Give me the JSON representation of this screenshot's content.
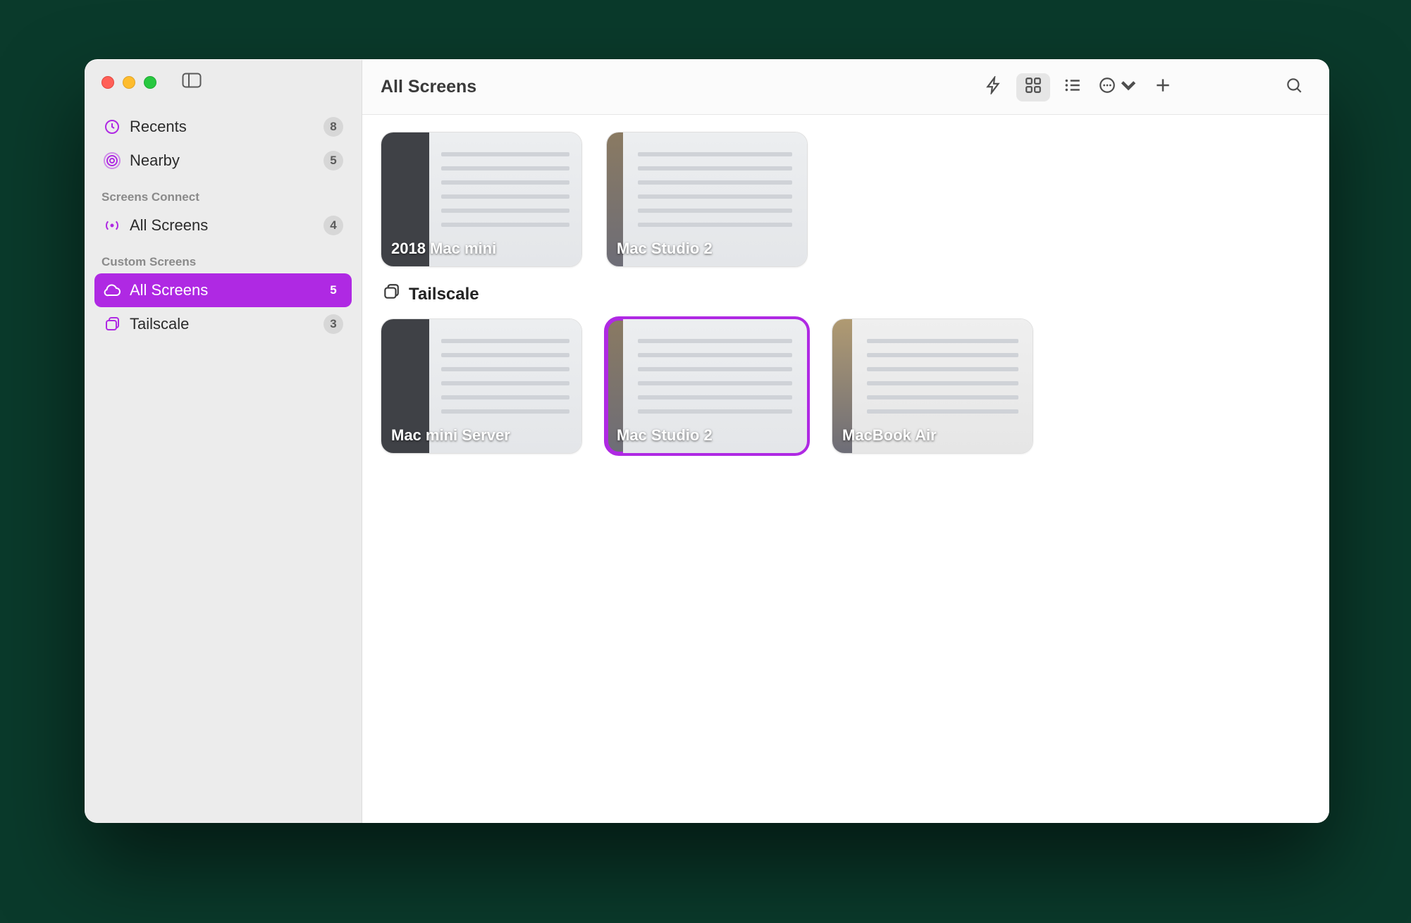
{
  "colors": {
    "accent": "#af29e3"
  },
  "toolbar": {
    "title": "All Screens"
  },
  "sidebar": {
    "top": [
      {
        "icon": "clock",
        "label": "Recents",
        "badge": "8"
      },
      {
        "icon": "nearby",
        "label": "Nearby",
        "badge": "5"
      }
    ],
    "sections": [
      {
        "header": "Screens Connect",
        "items": [
          {
            "icon": "broadcast",
            "label": "All Screens",
            "badge": "4",
            "selected": false
          }
        ]
      },
      {
        "header": "Custom Screens",
        "items": [
          {
            "icon": "cloud",
            "label": "All Screens",
            "badge": "5",
            "selected": true
          },
          {
            "icon": "stack",
            "label": "Tailscale",
            "badge": "3",
            "selected": false
          }
        ]
      }
    ]
  },
  "groups": [
    {
      "header": null,
      "items": [
        {
          "label": "2018 Mac mini",
          "variant": "1",
          "selected": false
        },
        {
          "label": "Mac Studio 2",
          "variant": "2",
          "selected": false
        }
      ]
    },
    {
      "header": "Tailscale",
      "items": [
        {
          "label": "Mac mini Server",
          "variant": "1",
          "selected": false
        },
        {
          "label": "Mac Studio 2",
          "variant": "2",
          "selected": true
        },
        {
          "label": "MacBook Air",
          "variant": "3",
          "selected": false
        }
      ]
    }
  ]
}
